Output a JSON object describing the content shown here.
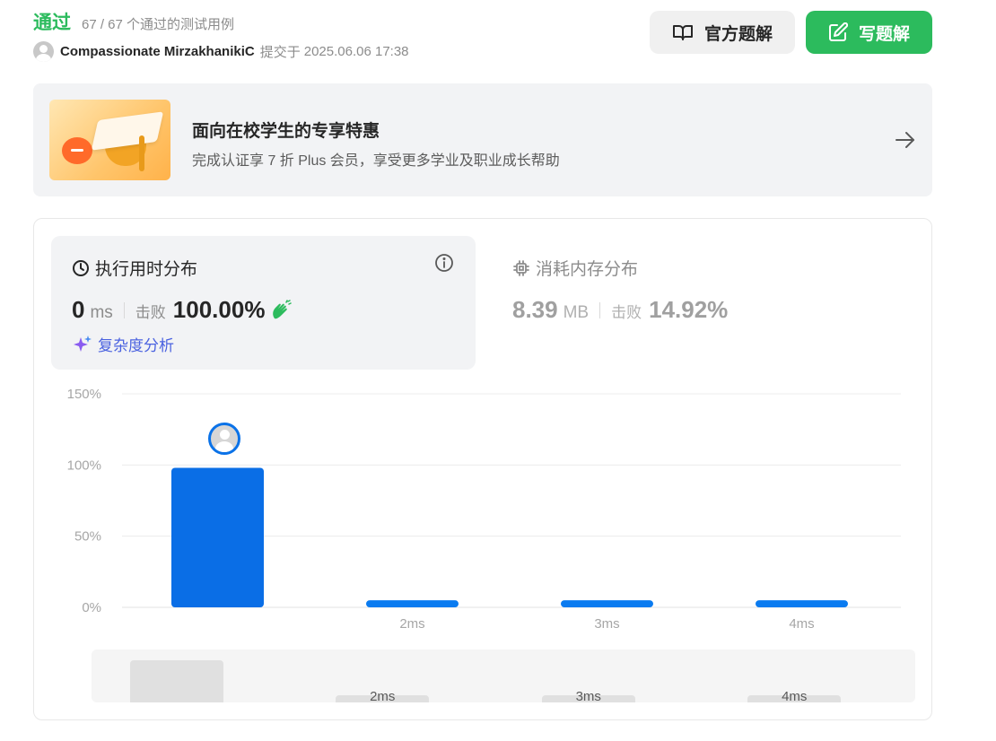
{
  "header": {
    "status": "通过",
    "tests_passed": "67 / 67 个通过的测试用例",
    "user": "Compassionate MirzakhanikiC",
    "submitted_label": "提交于",
    "submitted_time": "2025.06.06 17:38",
    "official_solution_label": "官方题解",
    "write_solution_label": "写题解"
  },
  "promo": {
    "title": "面向在校学生的专享特惠",
    "subtitle": "完成认证享 7 折 Plus 会员，享受更多学业及职业成长帮助"
  },
  "runtime": {
    "title": "执行用时分布",
    "value": "0",
    "unit": "ms",
    "beat_label": "击败",
    "beat_value": "100.00%",
    "complexity_link": "复杂度分析"
  },
  "memory": {
    "title": "消耗内存分布",
    "value": "8.39",
    "unit": "MB",
    "beat_label": "击败",
    "beat_value": "14.92%"
  },
  "colors": {
    "accent_green": "#2cbb5d",
    "bar_blue": "#0a6ee6",
    "link_purple": "#4a62e0"
  },
  "chart_data": {
    "type": "bar",
    "categories": [
      "",
      "2ms",
      "3ms",
      "4ms"
    ],
    "values": [
      98,
      5,
      5,
      5
    ],
    "yticks": [
      "0%",
      "50%",
      "100%",
      "150%"
    ],
    "ylim": [
      0,
      150
    ],
    "highlight_index": 0,
    "grid": true
  },
  "overview": {
    "labels": [
      "",
      "2ms",
      "3ms",
      "4ms"
    ]
  }
}
